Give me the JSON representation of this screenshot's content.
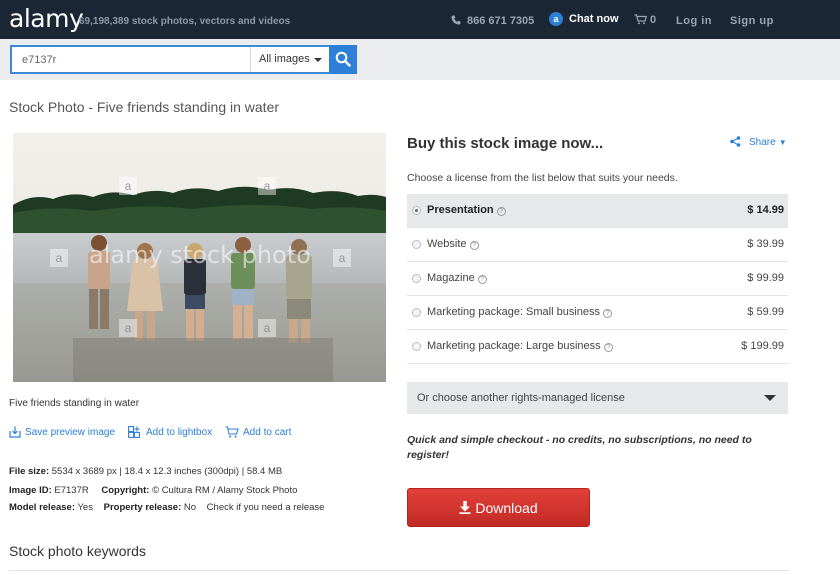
{
  "header": {
    "logo": "alamy",
    "tagline": "69,198,389  stock photos, vectors and videos",
    "phone": "866 671 7305",
    "chat_badge": "a",
    "chat_label": "Chat now",
    "cart_count": "0",
    "login": "Log in",
    "signup": "Sign up"
  },
  "search": {
    "value": "e7137r",
    "scope": "All images"
  },
  "page": {
    "title": "Stock Photo - Five friends standing in water",
    "caption": "Five friends standing in water",
    "watermark": "alamy stock photo",
    "watermark_badge": "a"
  },
  "actions": {
    "save_preview": "Save preview image",
    "add_lightbox": "Add to lightbox",
    "add_cart": "Add to cart"
  },
  "meta": {
    "file_size_label": "File size:",
    "file_size_value": "5534 x 3689 px | 18.4 x 12.3 inches (300dpi) | 58.4 MB",
    "image_id_label": "Image ID:",
    "image_id_value": "E7137R",
    "copyright_label": "Copyright:",
    "copyright_value": "© Cultura RM / Alamy Stock Photo",
    "model_release_label": "Model release:",
    "model_release_value": "Yes",
    "property_release_label": "Property release:",
    "property_release_value": "No",
    "check_release": "Check if you need a release"
  },
  "keywords": {
    "title": "Stock photo keywords"
  },
  "buy": {
    "title": "Buy this stock image now...",
    "share": "Share",
    "choose": "Choose a license from the list below that suits your needs.",
    "licenses": [
      {
        "name": "Presentation",
        "price": "$ 14.99"
      },
      {
        "name": "Website",
        "price": "$ 39.99"
      },
      {
        "name": "Magazine",
        "price": "$ 99.99"
      },
      {
        "name": "Marketing package: Small business",
        "price": "$ 59.99"
      },
      {
        "name": "Marketing package: Large business",
        "price": "$ 199.99"
      }
    ],
    "rights_managed": "Or choose another rights-managed license",
    "checkout_note": "Quick and simple checkout - no credits, no subscriptions, no need to register!",
    "download": "Download"
  },
  "colors": {
    "header_bg": "#1c2736",
    "accent_blue": "#2d7fd8",
    "download_red": "#d1342f"
  }
}
